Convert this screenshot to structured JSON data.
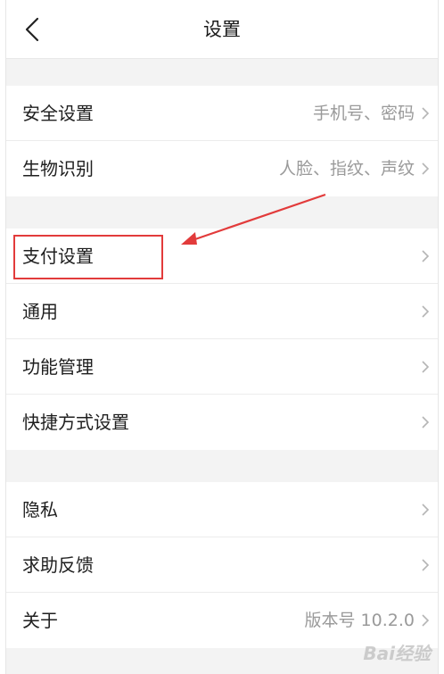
{
  "header": {
    "title": "设置"
  },
  "groups": [
    {
      "rows": [
        {
          "label": "安全设置",
          "value": "手机号、密码"
        },
        {
          "label": "生物识别",
          "value": "人脸、指纹、声纹"
        }
      ]
    },
    {
      "rows": [
        {
          "label": "支付设置",
          "value": ""
        },
        {
          "label": "通用",
          "value": ""
        },
        {
          "label": "功能管理",
          "value": ""
        },
        {
          "label": "快捷方式设置",
          "value": ""
        }
      ]
    },
    {
      "rows": [
        {
          "label": "隐私",
          "value": ""
        },
        {
          "label": "求助反馈",
          "value": ""
        },
        {
          "label": "关于",
          "value": "版本号 10.2.0"
        }
      ]
    }
  ],
  "annotation": {
    "color": "#e23b3b"
  },
  "watermark": "Bai经验"
}
